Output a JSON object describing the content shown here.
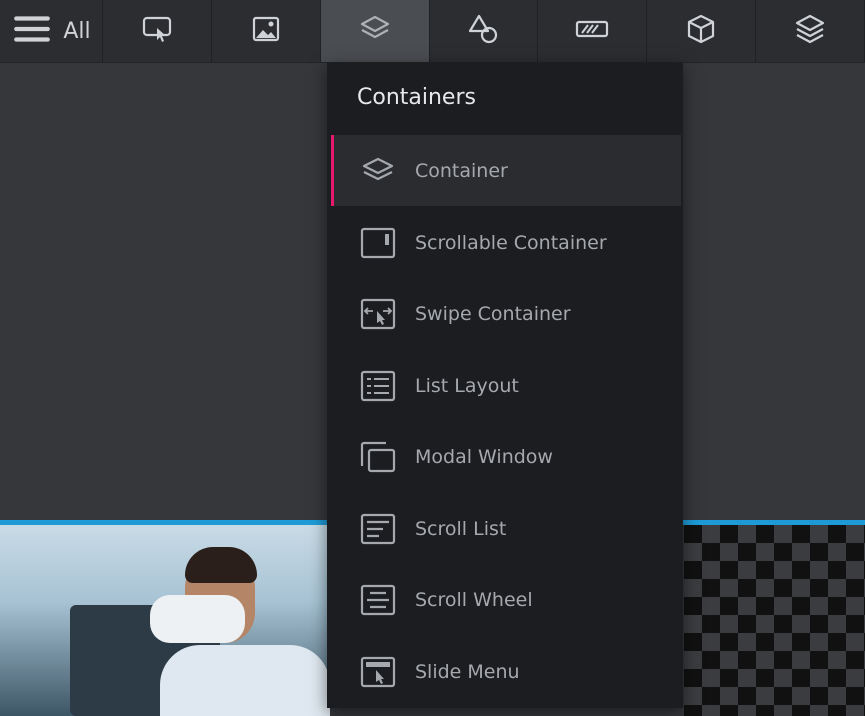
{
  "toolbar": {
    "all_label": "All",
    "tabs": [
      {
        "icon": "touch-screen-icon"
      },
      {
        "icon": "image-icon"
      },
      {
        "icon": "layers-icon",
        "active": true
      },
      {
        "icon": "shapes-icon"
      },
      {
        "icon": "progress-bar-icon"
      },
      {
        "icon": "cube-icon"
      },
      {
        "icon": "layers-stack-icon"
      }
    ]
  },
  "dropdown": {
    "title": "Containers",
    "items": [
      {
        "label": "Container",
        "icon": "layers-icon",
        "selected": true
      },
      {
        "label": "Scrollable Container",
        "icon": "scrollable-container-icon"
      },
      {
        "label": "Swipe Container",
        "icon": "swipe-container-icon"
      },
      {
        "label": "List Layout",
        "icon": "list-layout-icon"
      },
      {
        "label": "Modal Window",
        "icon": "modal-window-icon"
      },
      {
        "label": "Scroll List",
        "icon": "scroll-list-icon"
      },
      {
        "label": "Scroll Wheel",
        "icon": "scroll-wheel-icon"
      },
      {
        "label": "Slide Menu",
        "icon": "slide-menu-icon"
      }
    ]
  },
  "colors": {
    "accent": "#e6196e",
    "canvas_divider": "#1e9bd7"
  }
}
